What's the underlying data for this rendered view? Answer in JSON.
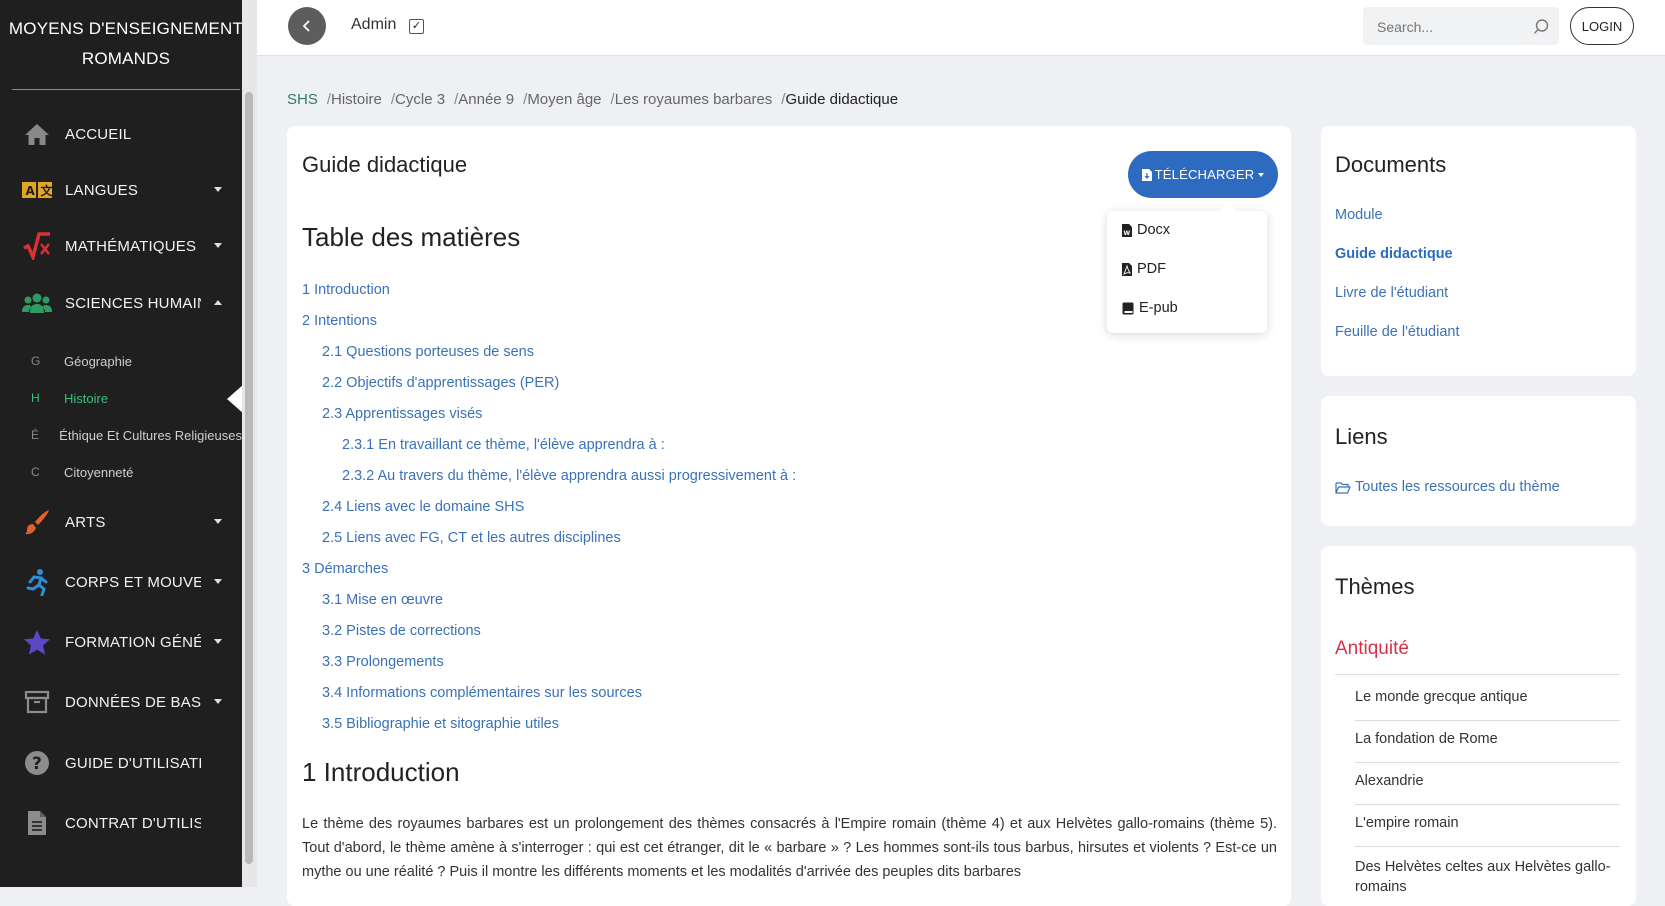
{
  "sidebar": {
    "brand": "MOYENS D'ENSEIGNEMENT ROMANDS",
    "items": [
      {
        "label": "ACCUEIL",
        "icon": "home-icon"
      },
      {
        "label": "LANGUES",
        "icon": "translate-icon"
      },
      {
        "label": "MATHÉMATIQUES ET SCIENCES DE LA NATURE",
        "icon": "math-icon"
      },
      {
        "label": "SCIENCES HUMAINES ET SOCIALES",
        "icon": "users-icon"
      },
      {
        "label": "ARTS",
        "icon": "brush-icon"
      },
      {
        "label": "CORPS ET MOUVEMENT",
        "icon": "running-icon"
      },
      {
        "label": "FORMATION GÉNÉRALE",
        "icon": "star-icon"
      },
      {
        "label": "DONNÉES DE BASE",
        "icon": "archive-icon"
      },
      {
        "label": "GUIDE D'UTILISATION",
        "icon": "question-icon"
      },
      {
        "label": "CONTRAT D'UTILISATION",
        "icon": "document-icon"
      }
    ],
    "subitems": [
      {
        "letter": "G",
        "label": "Géographie"
      },
      {
        "letter": "H",
        "label": "Histoire"
      },
      {
        "letter": "É",
        "label": "Éthique Et Cultures Religieuses"
      },
      {
        "letter": "C",
        "label": "Citoyenneté"
      }
    ]
  },
  "topbar": {
    "admin_label": "Admin",
    "admin_checked": "✓",
    "search_placeholder": "Search...",
    "login_label": "LOGIN"
  },
  "breadcrumb": [
    "SHS",
    "Histoire",
    "Cycle 3",
    "Année 9",
    "Moyen âge",
    "Les royaumes barbares",
    "Guide didactique"
  ],
  "main": {
    "title": "Guide didactique",
    "download_label": "TÉLÉCHARGER",
    "download_options": [
      "Docx",
      "PDF",
      "E-pub"
    ],
    "toc_title": "Table des matières",
    "toc": [
      {
        "label": "1 Introduction",
        "level": 1
      },
      {
        "label": "2 Intentions",
        "level": 1
      },
      {
        "label": "2.1 Questions porteuses de sens",
        "level": 2
      },
      {
        "label": "2.2 Objectifs d'apprentissages (PER)",
        "level": 2
      },
      {
        "label": "2.3 Apprentissages visés",
        "level": 2
      },
      {
        "label": "2.3.1 En travaillant ce thème, l'élève apprendra à :",
        "level": 3
      },
      {
        "label": "2.3.2 Au travers du thème, l'élève apprendra aussi progressivement à :",
        "level": 3
      },
      {
        "label": "2.4 Liens avec le domaine SHS",
        "level": 2
      },
      {
        "label": "2.5 Liens avec FG, CT et les autres disciplines",
        "level": 2
      },
      {
        "label": "3 Démarches",
        "level": 1
      },
      {
        "label": "3.1 Mise en œuvre",
        "level": 2
      },
      {
        "label": "3.2 Pistes de corrections",
        "level": 2
      },
      {
        "label": "3.3 Prolongements",
        "level": 2
      },
      {
        "label": "3.4 Informations complémentaires sur les sources",
        "level": 2
      },
      {
        "label": "3.5 Bibliographie et sitographie utiles",
        "level": 2
      }
    ],
    "section_title": "1 Introduction",
    "intro_text": "Le thème des royaumes barbares est un prolongement des thèmes consacrés à l'Empire romain (thème 4) et aux Helvètes gallo-romains (thème 5). Tout d'abord, le thème amène à s'interroger : qui est cet étranger, dit le « barbare » ? Les hommes sont-ils tous barbus, hirsutes et violents ? Est-ce un mythe ou une réalité ? Puis il montre les différents moments et les modalités d'arrivée des peuples dits barbares"
  },
  "documents": {
    "title": "Documents",
    "links": [
      "Module",
      "Guide didactique",
      "Livre de l'étudiant",
      "Feuille de l'étudiant"
    ],
    "active": "Guide didactique"
  },
  "liens": {
    "title": "Liens",
    "link": "Toutes les ressources du thème"
  },
  "themes": {
    "title": "Thèmes",
    "era": "Antiquité",
    "items": [
      "Le monde grecque antique",
      "La fondation de Rome",
      "Alexandrie",
      "L'empire romain",
      "Des Helvètes celtes aux Helvètes gallo-romains"
    ]
  },
  "colors": {
    "sidebar_bg": "#1f1f1f",
    "accent_green": "#34c27a",
    "link_blue": "#3a72b8",
    "button_blue": "#2c6bbf",
    "era_red": "#d9304a"
  }
}
